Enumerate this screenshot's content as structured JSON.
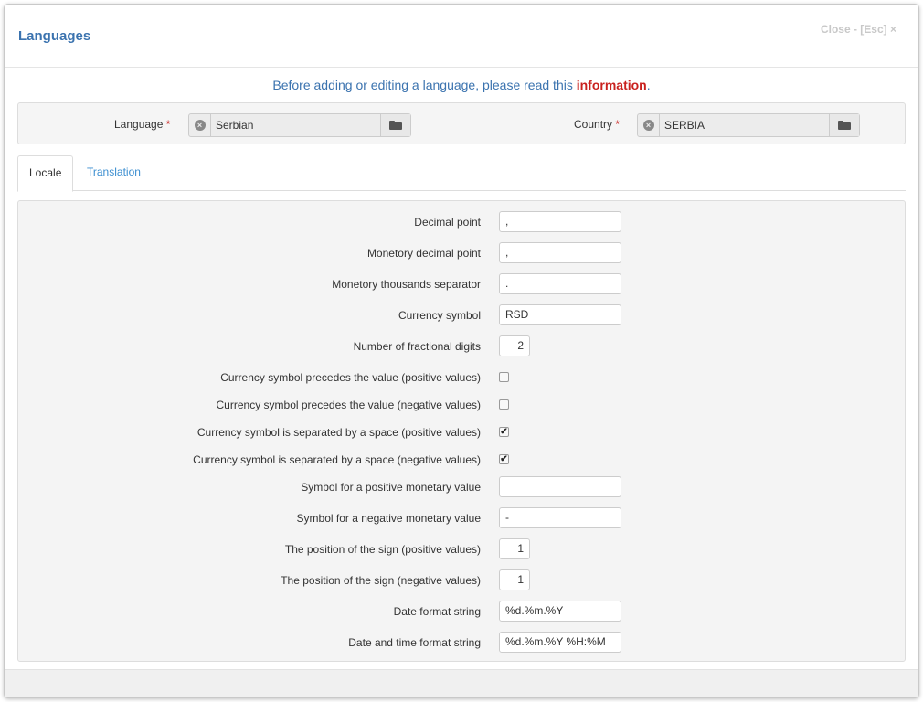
{
  "dialog": {
    "title": "Languages",
    "close_label": "Close - [Esc] ×"
  },
  "info": {
    "text": "Before adding or editing a language, please read this ",
    "link": "information",
    "suffix": "."
  },
  "top": {
    "language_label": "Language",
    "language_value": "Serbian",
    "country_label": "Country",
    "country_value": "SERBIA",
    "required_mark": "*"
  },
  "tabs": [
    {
      "label": "Locale",
      "active": true
    },
    {
      "label": "Translation",
      "active": false
    }
  ],
  "form": {
    "decimal_point": {
      "label": "Decimal point",
      "value": ","
    },
    "monetary_decimal_point": {
      "label": "Monetory decimal point",
      "value": ","
    },
    "monetary_thousands_separator": {
      "label": "Monetory thousands separator",
      "value": "."
    },
    "currency_symbol": {
      "label": "Currency symbol",
      "value": "RSD"
    },
    "fractional_digits": {
      "label": "Number of fractional digits",
      "value": "2"
    },
    "precedes_positive": {
      "label": "Currency symbol precedes the value (positive values)",
      "checked": false
    },
    "precedes_negative": {
      "label": "Currency symbol precedes the value (negative values)",
      "checked": false
    },
    "space_positive": {
      "label": "Currency symbol is separated by a space (positive values)",
      "checked": true
    },
    "space_negative": {
      "label": "Currency symbol is separated by a space (negative values)",
      "checked": true
    },
    "positive_sign": {
      "label": "Symbol for a positive monetary value",
      "value": ""
    },
    "negative_sign": {
      "label": "Symbol for a negative monetary value",
      "value": "-"
    },
    "sign_position_positive": {
      "label": "The position of the sign (positive values)",
      "value": "1"
    },
    "sign_position_negative": {
      "label": "The position of the sign (negative values)",
      "value": "1"
    },
    "date_format": {
      "label": "Date format string",
      "value": "%d.%m.%Y"
    },
    "datetime_format": {
      "label": "Date and time format string",
      "value": "%d.%m.%Y %H:%M"
    }
  },
  "icons": {
    "clear": "clear-icon",
    "browse": "folder-open-icon",
    "checkmark": "✔"
  },
  "colors": {
    "title": "#3b73af",
    "link_red": "#c9211e",
    "tab_link": "#3b8ed0"
  }
}
